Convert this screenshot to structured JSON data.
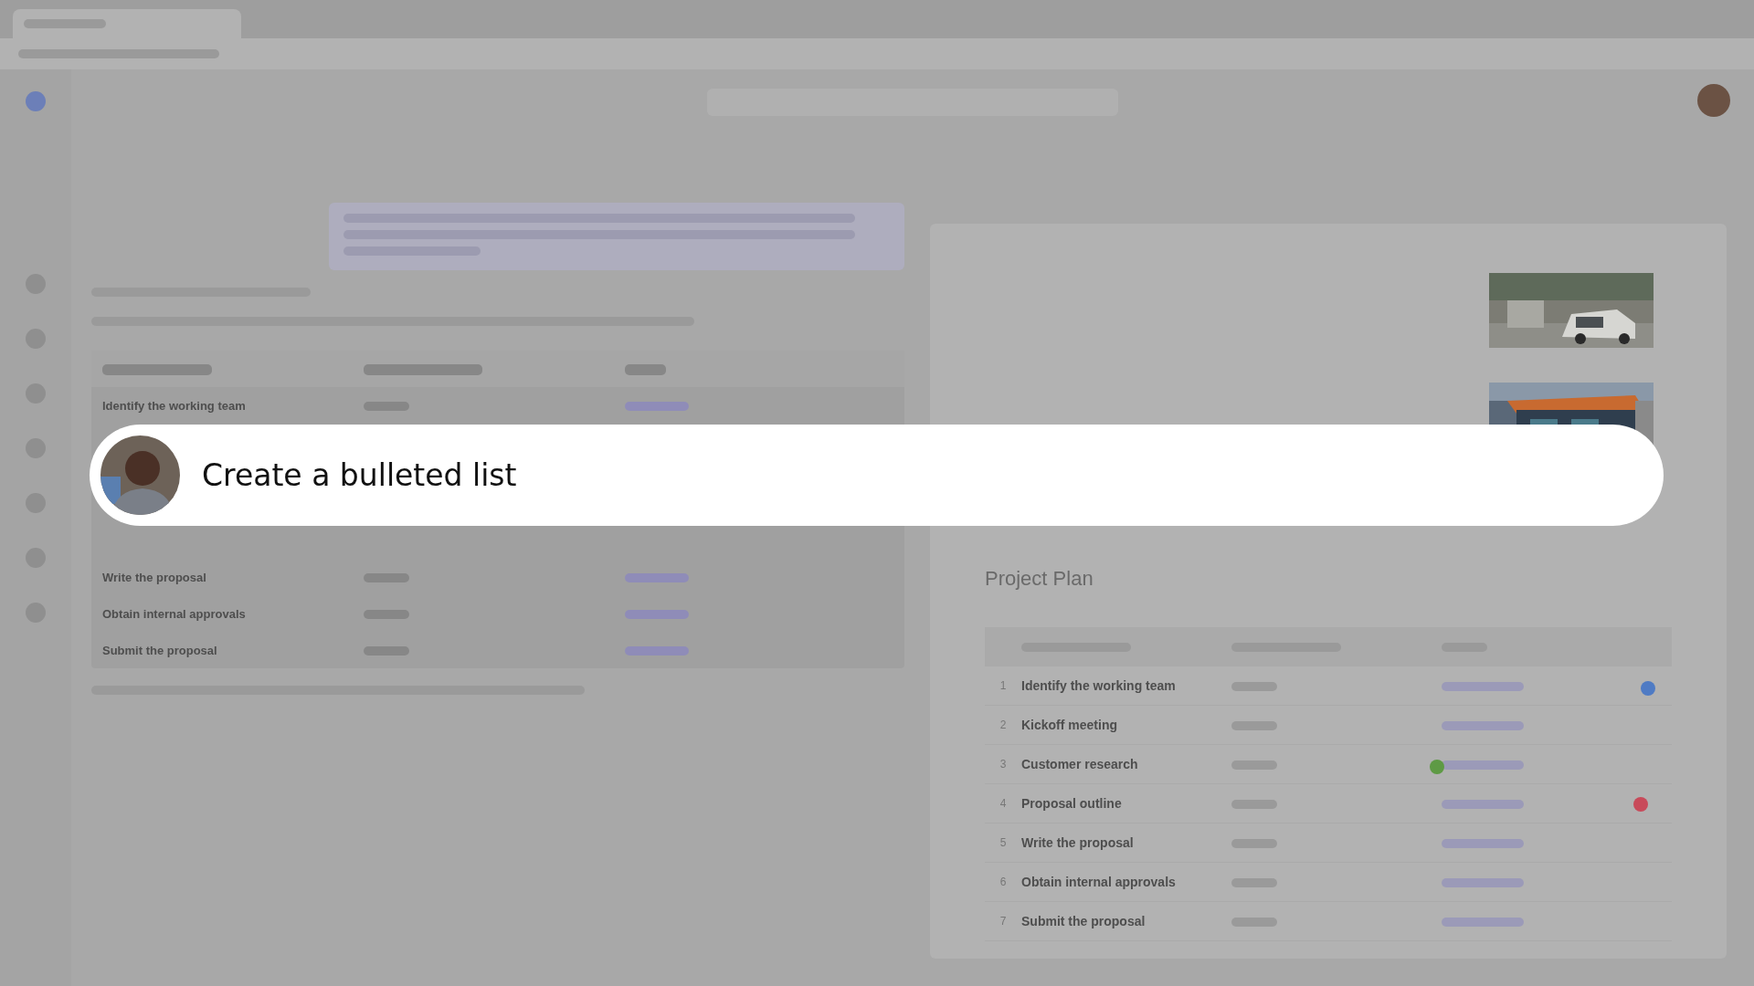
{
  "caption": {
    "text": "Create a bulleted list"
  },
  "chat": {
    "table": {
      "rows": [
        {
          "milestone": "Identify the working team"
        },
        {
          "milestone": "Write the proposal"
        },
        {
          "milestone": "Obtain internal approvals"
        },
        {
          "milestone": "Submit the proposal"
        }
      ]
    }
  },
  "document": {
    "title": "Project Plan",
    "table": {
      "rows": [
        {
          "number": "1",
          "milestone": "Identify the working team"
        },
        {
          "number": "2",
          "milestone": "Kickoff meeting"
        },
        {
          "number": "3",
          "milestone": "Customer research"
        },
        {
          "number": "4",
          "milestone": "Proposal outline"
        },
        {
          "number": "5",
          "milestone": "Write the proposal"
        },
        {
          "number": "6",
          "milestone": "Obtain internal approvals"
        },
        {
          "number": "7",
          "milestone": "Submit the proposal"
        }
      ]
    },
    "cursors": [
      {
        "color": "#4f7bc4"
      },
      {
        "color": "#5e9a45"
      },
      {
        "color": "#c84a5a"
      }
    ]
  }
}
